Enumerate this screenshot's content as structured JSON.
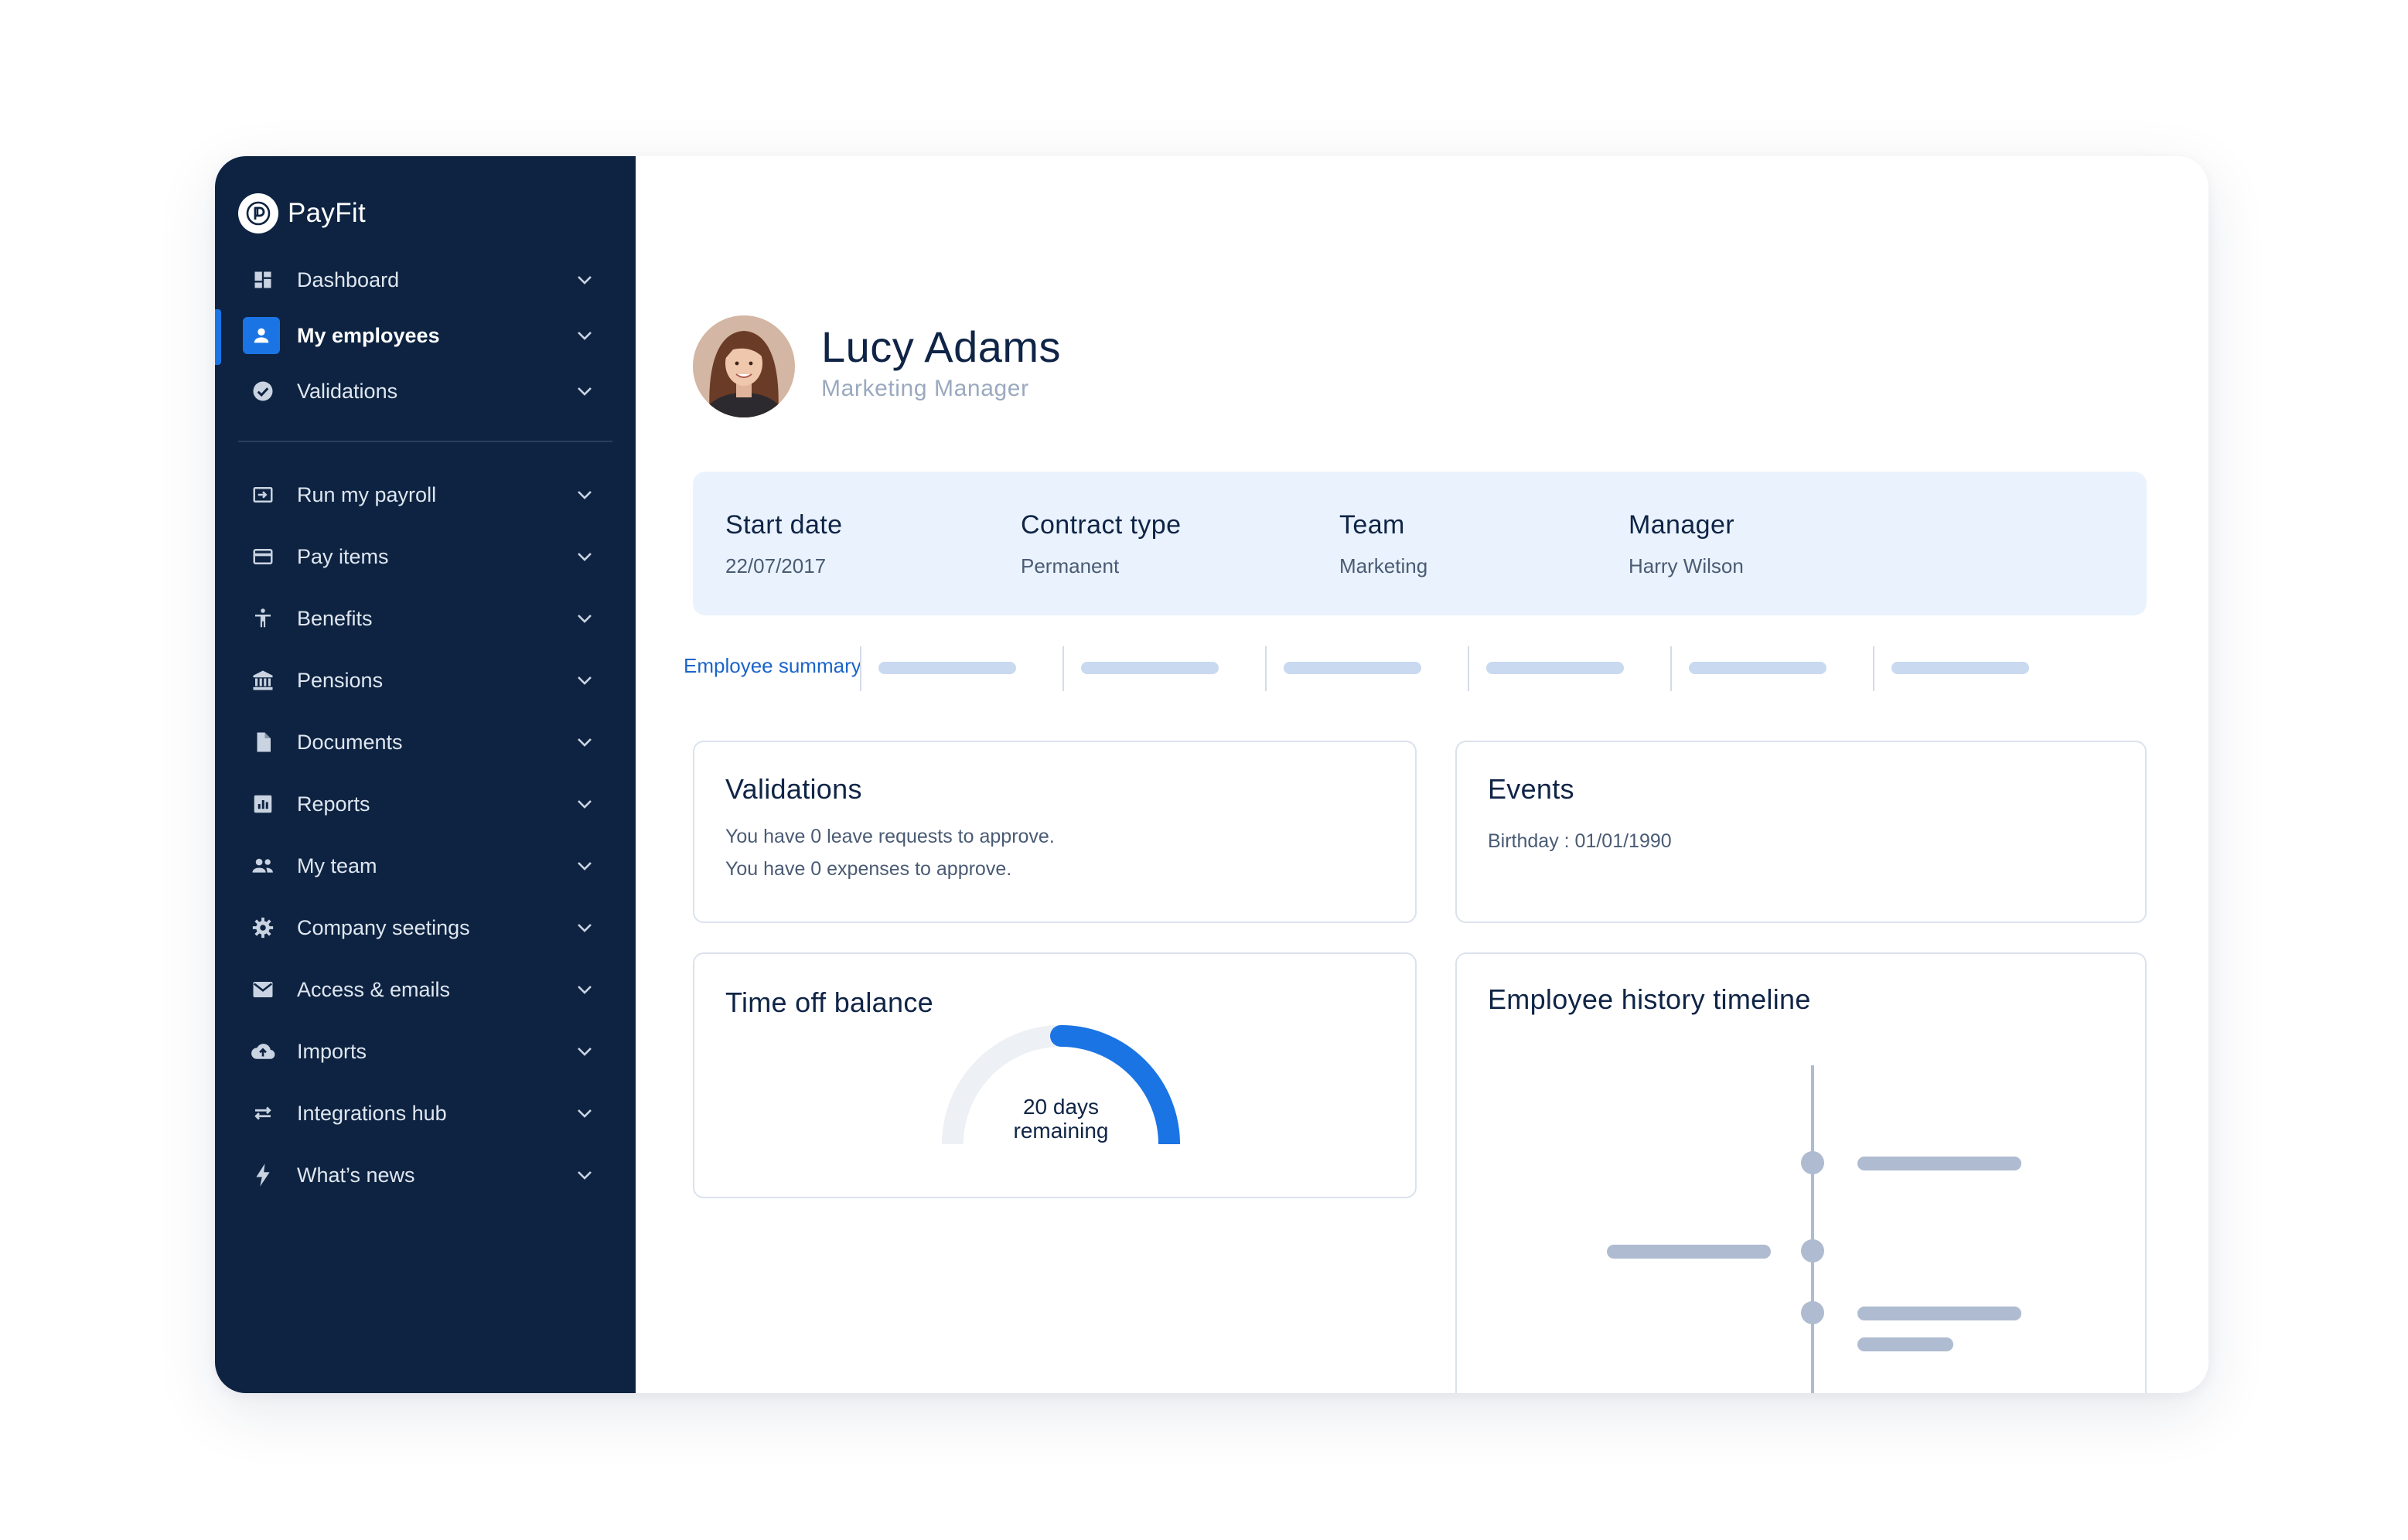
{
  "app": {
    "brand": "PayFit"
  },
  "sidebar": {
    "items": [
      {
        "label": "Dashboard",
        "icon": "dashboard-icon"
      },
      {
        "label": "My employees",
        "icon": "person-icon",
        "active": true
      },
      {
        "label": "Validations",
        "icon": "check-circle-icon"
      },
      {
        "label": "Run my payroll",
        "icon": "payroll-icon"
      },
      {
        "label": "Pay items",
        "icon": "card-icon"
      },
      {
        "label": "Benefits",
        "icon": "accessibility-icon"
      },
      {
        "label": "Pensions",
        "icon": "bank-icon"
      },
      {
        "label": "Documents",
        "icon": "document-icon"
      },
      {
        "label": "Reports",
        "icon": "chart-icon"
      },
      {
        "label": "My team",
        "icon": "group-icon"
      },
      {
        "label": "Company seetings",
        "icon": "gear-icon"
      },
      {
        "label": "Access & emails",
        "icon": "mail-icon"
      },
      {
        "label": "Imports",
        "icon": "cloud-upload-icon"
      },
      {
        "label": "Integrations hub",
        "icon": "swap-icon"
      },
      {
        "label": "What’s news",
        "icon": "bolt-icon"
      }
    ]
  },
  "employee": {
    "name": "Lucy Adams",
    "role": "Marketing Manager",
    "avatar": "employee-photo"
  },
  "info": {
    "start_date": {
      "label": "Start date",
      "value": "22/07/2017"
    },
    "contract_type": {
      "label": "Contract type",
      "value": "Permanent"
    },
    "team": {
      "label": "Team",
      "value": "Marketing"
    },
    "manager": {
      "label": "Manager",
      "value": "Harry Wilson"
    }
  },
  "tabs": {
    "active": "Employee summary"
  },
  "validations": {
    "title": "Validations",
    "line1": "You have 0 leave requests to approve.",
    "line2": "You have 0 expenses to approve."
  },
  "events": {
    "title": "Events",
    "line1": "Birthday : 01/01/1990"
  },
  "time_off": {
    "title": "Time off balance",
    "gauge_fraction": 0.5,
    "line1": "20 days",
    "line2": "remaining"
  },
  "history": {
    "title": "Employee history timeline"
  },
  "colors": {
    "sidebar": "#0d2341",
    "accent": "#1b74e4",
    "info_band": "#eaf3fd",
    "placeholder": "#c8d9f0",
    "timeline": "#aebbd0"
  }
}
